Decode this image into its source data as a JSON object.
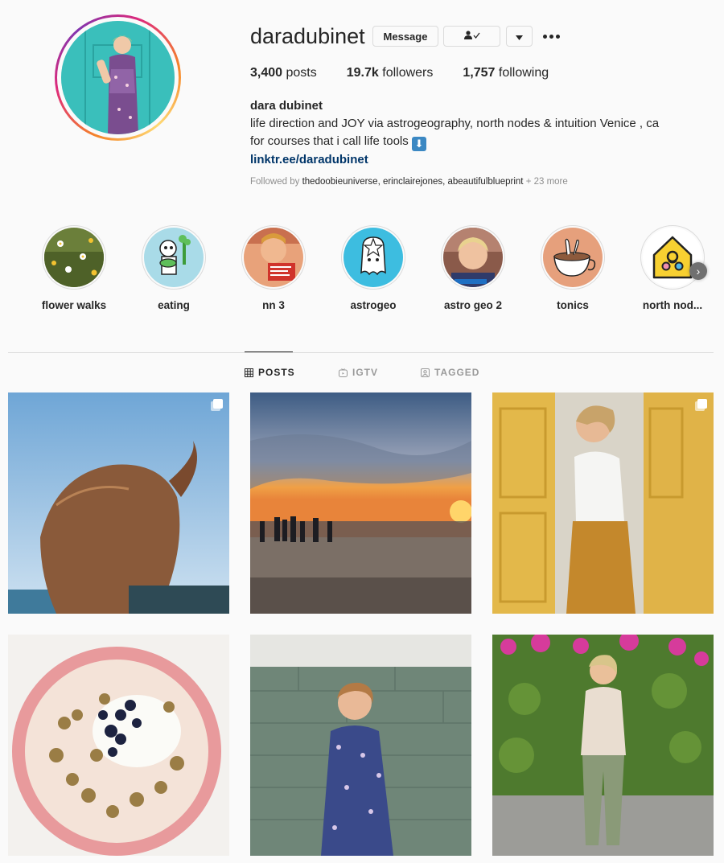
{
  "profile": {
    "username": "daradubinet",
    "message_label": "Message",
    "follow_icon": "person-check-icon",
    "dropdown_icon": "caret-down-icon",
    "more_icon": "more-dots-icon",
    "stats": [
      {
        "count": "3,400",
        "label": "posts"
      },
      {
        "count": "19.7k",
        "label": "followers"
      },
      {
        "count": "1,757",
        "label": "following"
      }
    ],
    "full_name": "dara dubinet",
    "bio_line1": "life direction and JOY via astrogeography, north nodes & intuition Venice , ca",
    "bio_line2": "for courses that i call life tools",
    "bio_emoji": "⬇",
    "link": "linktr.ee/daradubinet",
    "followed_prefix": "Followed by",
    "followed_names": "thedoobieuniverse, erinclairejones, abeautifulblueprint",
    "followed_more": "+ 23 more"
  },
  "highlights": [
    {
      "label": "flower walks",
      "icon": "flower-photo"
    },
    {
      "label": "eating",
      "icon": "eating-cartoon-icon"
    },
    {
      "label": "nn 3",
      "icon": "selfie-photo"
    },
    {
      "label": "astrogeo",
      "icon": "astrogeo-cartoon-icon"
    },
    {
      "label": "astro geo 2",
      "icon": "portrait-photo"
    },
    {
      "label": "tonics",
      "icon": "tonic-cup-icon"
    },
    {
      "label": "north nod...",
      "icon": "house-icon"
    }
  ],
  "tabs": [
    {
      "label": "POSTS",
      "icon": "grid-icon",
      "active": true
    },
    {
      "label": "IGTV",
      "icon": "igtv-icon",
      "active": false
    },
    {
      "label": "TAGGED",
      "icon": "tagged-icon",
      "active": false
    }
  ],
  "colors": {
    "link": "#003569",
    "text": "#262626",
    "muted": "#8e8e8e",
    "border": "#dbdbdb",
    "background": "#fafafa"
  }
}
